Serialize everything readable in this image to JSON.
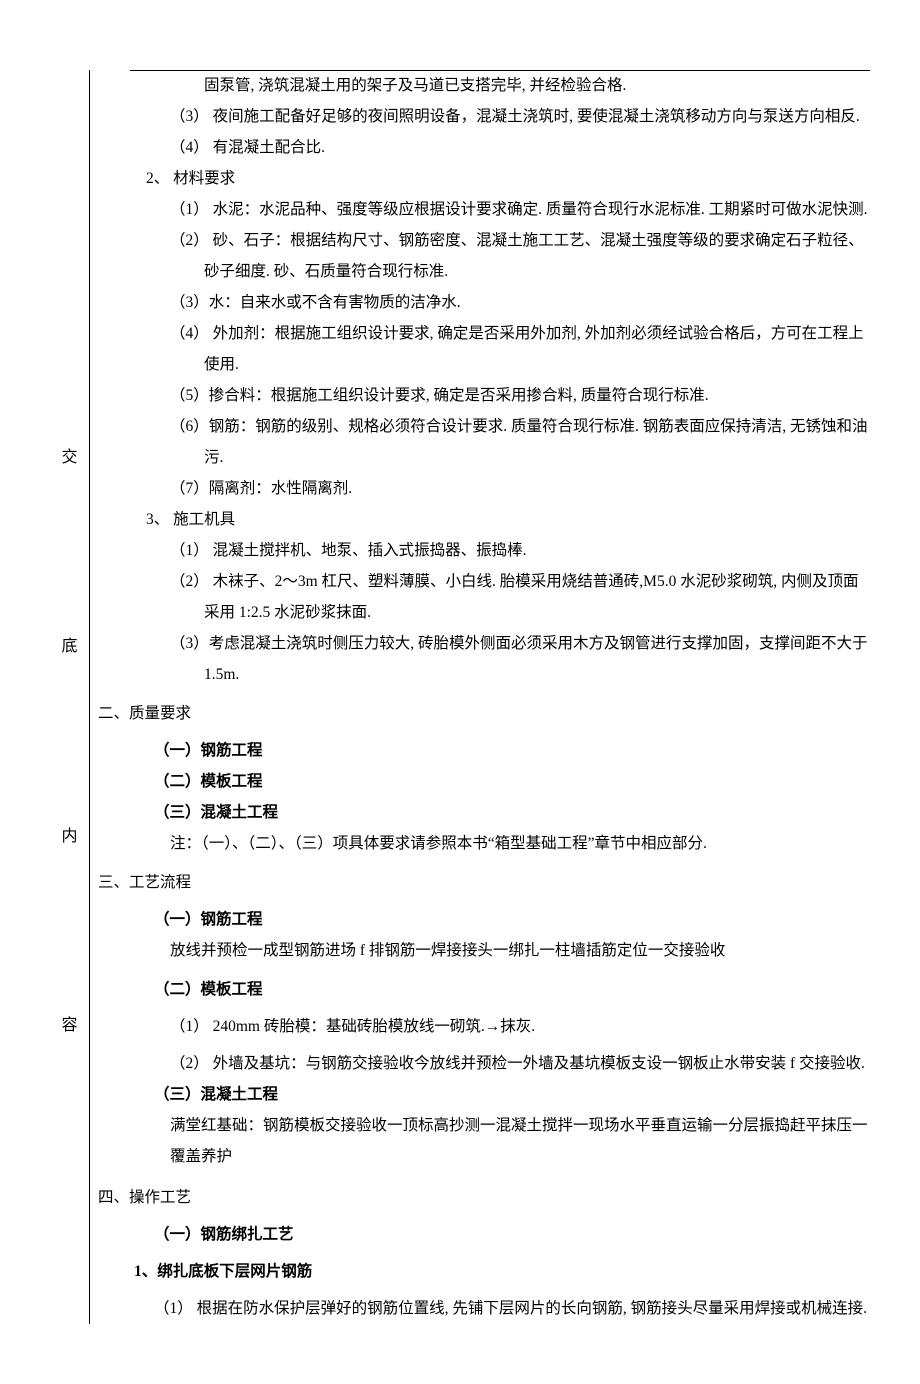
{
  "sidebar": {
    "c1": "交",
    "c2": "底",
    "c3": "内",
    "c4": "容"
  },
  "top": {
    "l1": "固泵管, 浇筑混凝土用的架子及马道已支搭完毕, 并经检验合格.",
    "l2": "（3） 夜间施工配备好足够的夜间照明设备，混凝土浇筑时, 要使混凝土浇筑移动方向与泵送方向相反.",
    "l3": "（4） 有混凝土配合比."
  },
  "mat": {
    "h": "2、  材料要求",
    "i1": "（1） 水泥：水泥品种、强度等级应根据设计要求确定. 质量符合现行水泥标准. 工期紧时可做水泥快测.",
    "i2": "（2） 砂、石子：根据结构尺寸、钢筋密度、混凝土施工工艺、混凝土强度等级的要求确定石子粒径、砂子细度. 砂、石质量符合现行标准.",
    "i3": "（3）水：自来水或不含有害物质的洁净水.",
    "i4": "（4） 外加剂：根据施工组织设计要求, 确定是否采用外加剂, 外加剂必须经试验合格后，方可在工程上使用.",
    "i5": "（5）掺合料：根据施工组织设计要求, 确定是否采用掺合料, 质量符合现行标准.",
    "i6": "（6）钢筋：钢筋的级别、规格必须符合设计要求. 质量符合现行标准. 钢筋表面应保持清洁, 无锈蚀和油污.",
    "i7": "（7）隔离剂：水性隔离剂."
  },
  "mach": {
    "h": "3、  施工机具",
    "i1": "（1） 混凝土搅拌机、地泵、插入式振捣器、振捣棒.",
    "i2": "（2） 木袜子、2～3m 杠尺、塑料薄膜、小白线. 胎模采用烧结普通砖,M5.0 水泥砂浆砌筑, 内侧及顶面采用 1:2.5 水泥砂浆抹面.",
    "i3": "（3）考虑混凝土浇筑时侧压力较大, 砖胎模外侧面必须采用木方及钢管进行支撑加固，支撑间距不大于 1.5m."
  },
  "qual": {
    "h": "二、质量要求",
    "s1": "（一）钢筋工程",
    "s2": "（二）模板工程",
    "s3": "（三）混凝土工程",
    "note": "注：（一）、（二）、（三）项具体要求请参照本书“箱型基础工程”章节中相应部分."
  },
  "proc": {
    "h": "三、工艺流程",
    "s1": "（一）钢筋工程",
    "l1": "放线并预检一成型钢筋进场 f 排钢筋一焊接接头一绑扎一柱墙插筋定位一交接验收",
    "s2": "（二）模板工程",
    "i1": "（1） 240mm 砖胎模：基础砖胎模放线一砌筑.→抹灰.",
    "i2": "（2） 外墙及基坑：与钢筋交接验收今放线并预检一外墙及基坑模板支设一钢板止水带安装 f 交接验收.",
    "s3": "（三）混凝土工程",
    "l3": "满堂红基础：钢筋模板交接验收一顶标高抄测一混凝土搅拌一现场水平垂直运输一分层振捣赶平抹压一覆盖养护"
  },
  "op": {
    "h": "四、操作工艺",
    "s1": "（一）钢筋绑扎工艺",
    "sub": "1、绑扎底板下层网片钢筋",
    "i1": "（1） 根据在防水保护层弹好的钢筋位置线, 先铺下层网片的长向钢筋, 钢筋接头尽量采用焊接或机械连接."
  }
}
